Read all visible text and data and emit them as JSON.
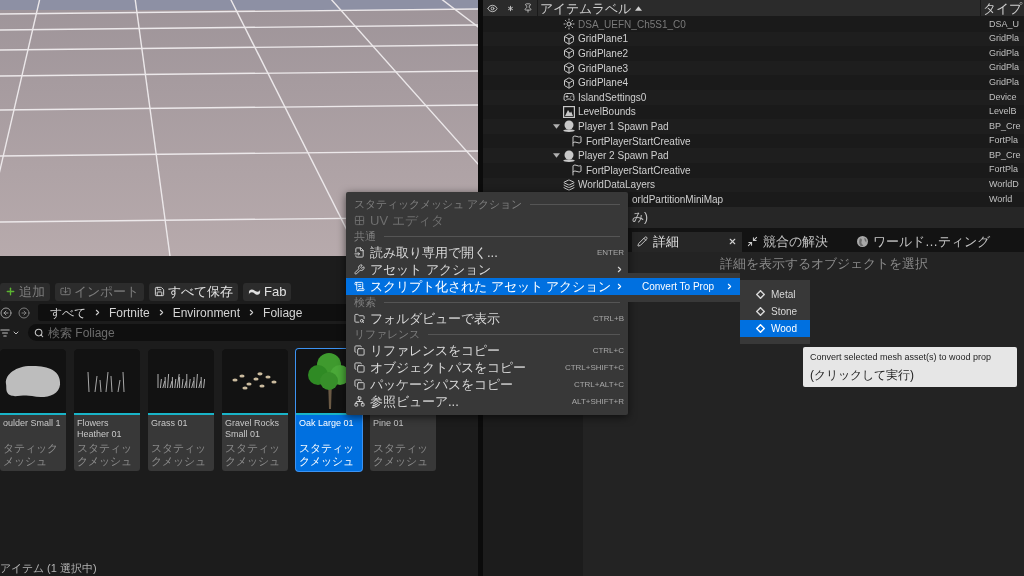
{
  "outliner": {
    "columns": [
      "アイテムラベル",
      "タイプ"
    ],
    "rows": [
      {
        "label": "DSA_UEFN_Ch5S1_C0",
        "type": "DSA_U",
        "kind": "light",
        "dimmed": true
      },
      {
        "label": "GridPlane1",
        "type": "GridPla",
        "kind": "mesh",
        "dimmed": false
      },
      {
        "label": "GridPlane2",
        "type": "GridPla",
        "kind": "mesh",
        "dimmed": false
      },
      {
        "label": "GridPlane3",
        "type": "GridPla",
        "kind": "mesh",
        "dimmed": false
      },
      {
        "label": "GridPlane4",
        "type": "GridPla",
        "kind": "mesh",
        "dimmed": false
      },
      {
        "label": "IslandSettings0",
        "type": "Device",
        "kind": "device",
        "dimmed": false
      },
      {
        "label": "LevelBounds",
        "type": "LevelB",
        "kind": "bounds",
        "dimmed": false
      },
      {
        "label": "Player 1 Spawn Pad",
        "type": "BP_Cre",
        "kind": "spawn",
        "dimmed": false,
        "expanded": true,
        "children": [
          {
            "label": "FortPlayerStartCreative",
            "type": "FortPla",
            "kind": "start",
            "dimmed": false
          }
        ]
      },
      {
        "label": "Player 2 Spawn Pad",
        "type": "BP_Cre",
        "kind": "spawn",
        "dimmed": false,
        "expanded": true,
        "children": [
          {
            "label": "FortPlayerStartCreative",
            "type": "FortPla",
            "kind": "start",
            "dimmed": false
          }
        ]
      },
      {
        "label": "WorldDataLayers",
        "type": "WorldD",
        "kind": "layers",
        "dimmed": false
      },
      {
        "label": "orldPartitionMiniMap",
        "type": "World",
        "dimmed": false
      }
    ],
    "status": "み)"
  },
  "content_browser": {
    "toolbar": [
      {
        "label": "追加",
        "kind": "add",
        "disabled": true
      },
      {
        "label": "インポート",
        "kind": "import",
        "disabled": true
      },
      {
        "label": "すべて保存",
        "kind": "save",
        "disabled": false
      },
      {
        "label": "Fab",
        "kind": "fab",
        "disabled": false
      }
    ],
    "breadcrumb": [
      "すべて",
      "Fortnite",
      "Environment",
      "Foliage"
    ],
    "search": {
      "placeholder": "検索 Foliage"
    },
    "assets": [
      {
        "name": "oulder Small 1",
        "type": "タティックメッシュ",
        "kind": "boulder",
        "selected": false
      },
      {
        "name": "Flowers Heather 01",
        "type": "スタティックメッシュ",
        "kind": "flowers",
        "selected": false
      },
      {
        "name": "Grass 01",
        "type": "スタティックメッシュ",
        "kind": "grass",
        "selected": false
      },
      {
        "name": "Gravel Rocks Small 01",
        "type": "スタティックメッシュ",
        "kind": "gravel",
        "selected": false
      },
      {
        "name": "Oak Large 01",
        "type": "スタティックメッシュ",
        "kind": "tree",
        "selected": true
      },
      {
        "name": "Pine 01",
        "type": "スタティックメッシュ",
        "selected": false
      }
    ],
    "status": "アイテム (1 選択中)"
  },
  "details": {
    "tabs": [
      {
        "label": "詳細",
        "kind": "details",
        "selected": true,
        "closable": true
      },
      {
        "label": "競合の解決",
        "kind": "conflicts",
        "selected": false,
        "closable": false
      },
      {
        "label": "ワールド…ティング",
        "kind": "world",
        "selected": false,
        "closable": false
      }
    ],
    "message": "詳細を表示するオブジェクトを選択"
  },
  "context_menu": {
    "items": [
      {
        "kind": "section",
        "label": "スタティックメッシュ アクション"
      },
      {
        "kind": "editor",
        "label": "UV エディタ",
        "disabled": true,
        "selected": false,
        "submenu": false
      },
      {
        "kind": "section",
        "label": "共通"
      },
      {
        "kind": "open",
        "label": "読み取り専用で開く...",
        "shortcut": "ENTER",
        "disabled": false,
        "selected": false,
        "submenu": false
      },
      {
        "kind": "actions",
        "label": "アセット アクション",
        "disabled": false,
        "selected": false,
        "submenu": true
      },
      {
        "kind": "scripted",
        "label": "スクリプト化された アセット アクション",
        "disabled": false,
        "selected": true,
        "submenu": true
      },
      {
        "kind": "section",
        "label": "検索"
      },
      {
        "kind": "browse",
        "label": "フォルダビューで表示",
        "shortcut": "CTRL+B",
        "disabled": false,
        "selected": false,
        "submenu": false
      },
      {
        "kind": "section",
        "label": "リファレンス"
      },
      {
        "kind": "copy",
        "label": "リファレンスをコピー",
        "shortcut": "CTRL+C",
        "disabled": false,
        "selected": false,
        "submenu": false
      },
      {
        "kind": "copy",
        "label": "オブジェクトパスをコピー",
        "shortcut": "CTRL+SHIFT+C",
        "disabled": false,
        "selected": false,
        "submenu": false
      },
      {
        "kind": "copy",
        "label": "パッケージパスをコピー",
        "shortcut": "CTRL+ALT+C",
        "disabled": false,
        "selected": false,
        "submenu": false
      },
      {
        "kind": "viewer",
        "label": "参照ビューア...",
        "shortcut": "ALT+SHIFT+R",
        "disabled": false,
        "selected": false,
        "submenu": false
      }
    ]
  },
  "scripted_submenu": {
    "items": [
      {
        "label": "Convert To Prop",
        "selected": true,
        "submenu": true
      }
    ]
  },
  "prop_submenu": {
    "items": [
      {
        "label": "Metal",
        "selected": false
      },
      {
        "label": "Stone",
        "selected": false
      },
      {
        "label": "Wood",
        "selected": true
      }
    ]
  },
  "tooltip": {
    "lines": [
      "Convert selected mesh asset(s) to wood prop",
      "(クリックして実行)"
    ]
  }
}
